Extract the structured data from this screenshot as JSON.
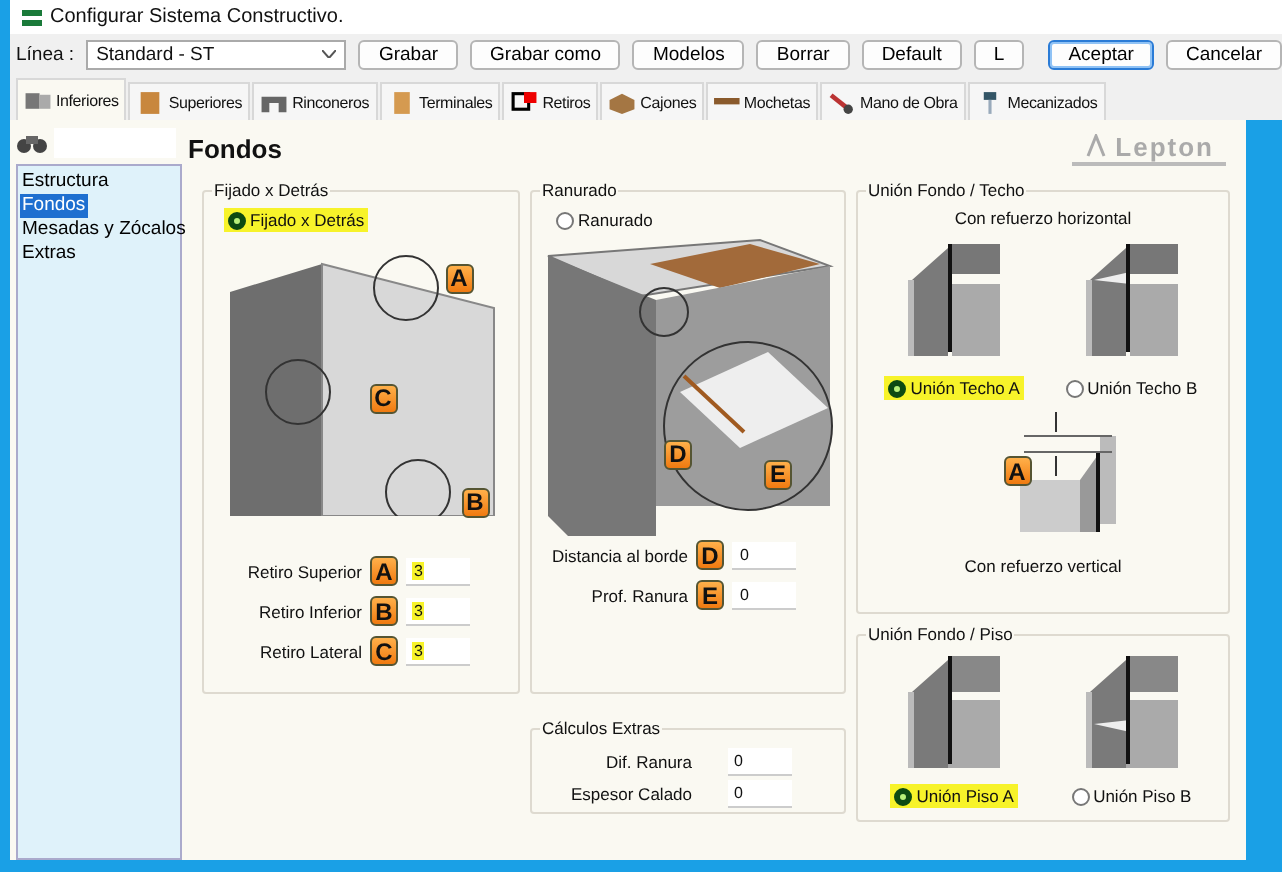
{
  "window": {
    "title": "Configurar Sistema Constructivo."
  },
  "toolbar": {
    "line_label": "Línea :",
    "line_value": "Standard - ST",
    "buttons": [
      {
        "label": "Grabar",
        "focused": false
      },
      {
        "label": "Grabar como",
        "focused": false
      },
      {
        "label": "Modelos",
        "focused": false
      },
      {
        "label": "Borrar",
        "focused": false
      },
      {
        "label": "Default",
        "focused": false
      },
      {
        "label": "L",
        "focused": false
      }
    ],
    "actions": [
      {
        "label": "Aceptar",
        "focused": true
      },
      {
        "label": "Cancelar",
        "focused": false
      }
    ]
  },
  "tabs": [
    {
      "label": "Inferiores",
      "selected": true
    },
    {
      "label": "Superiores",
      "selected": false
    },
    {
      "label": "Rinconeros",
      "selected": false
    },
    {
      "label": "Terminales",
      "selected": false
    },
    {
      "label": "Retiros",
      "selected": false
    },
    {
      "label": "Cajones",
      "selected": false
    },
    {
      "label": "Mochetas",
      "selected": false
    },
    {
      "label": "Mano de Obra",
      "selected": false
    },
    {
      "label": "Mecanizados",
      "selected": false
    }
  ],
  "sidebar": {
    "items": [
      {
        "label": "Estructura",
        "selected": false
      },
      {
        "label": "Fondos",
        "selected": true
      },
      {
        "label": "Mesadas y Zócalos",
        "selected": false
      },
      {
        "label": "Extras",
        "selected": false
      }
    ]
  },
  "heading": "Fondos",
  "logo": "Lepton",
  "fijado": {
    "title": "Fijado x Detrás",
    "option": {
      "label": "Fijado x Detrás",
      "checked": true,
      "highlighted": true
    },
    "callouts": [
      "A",
      "C",
      "B"
    ],
    "fields": [
      {
        "label": "Retiro Superior",
        "badge": "A",
        "value": "3",
        "highlighted": true
      },
      {
        "label": "Retiro Inferior",
        "badge": "B",
        "value": "3",
        "highlighted": true
      },
      {
        "label": "Retiro Lateral",
        "badge": "C",
        "value": "3",
        "highlighted": true
      }
    ]
  },
  "ranurado": {
    "title": "Ranurado",
    "option": {
      "label": "Ranurado",
      "checked": false,
      "highlighted": false
    },
    "callouts": [
      "D",
      "E"
    ],
    "fields": [
      {
        "label": "Distancia al borde",
        "badge": "D",
        "value": "0",
        "highlighted": false
      },
      {
        "label": "Prof. Ranura",
        "badge": "E",
        "value": "0",
        "highlighted": false
      }
    ]
  },
  "calculos": {
    "title": "Cálculos Extras",
    "fields": [
      {
        "label": "Dif. Ranura",
        "value": "0"
      },
      {
        "label": "Espesor Calado",
        "value": "0"
      }
    ]
  },
  "techo": {
    "title": "Unión Fondo / Techo",
    "caption_top": "Con refuerzo horizontal",
    "options": [
      {
        "label": "Unión Techo A",
        "checked": true,
        "highlighted": true
      },
      {
        "label": "Unión Techo B",
        "checked": false,
        "highlighted": false
      }
    ],
    "callout": "A",
    "caption_bottom": "Con refuerzo vertical"
  },
  "piso": {
    "title": "Unión Fondo / Piso",
    "options": [
      {
        "label": "Unión Piso A",
        "checked": true,
        "highlighted": true
      },
      {
        "label": "Unión Piso B",
        "checked": false,
        "highlighted": false
      }
    ]
  }
}
